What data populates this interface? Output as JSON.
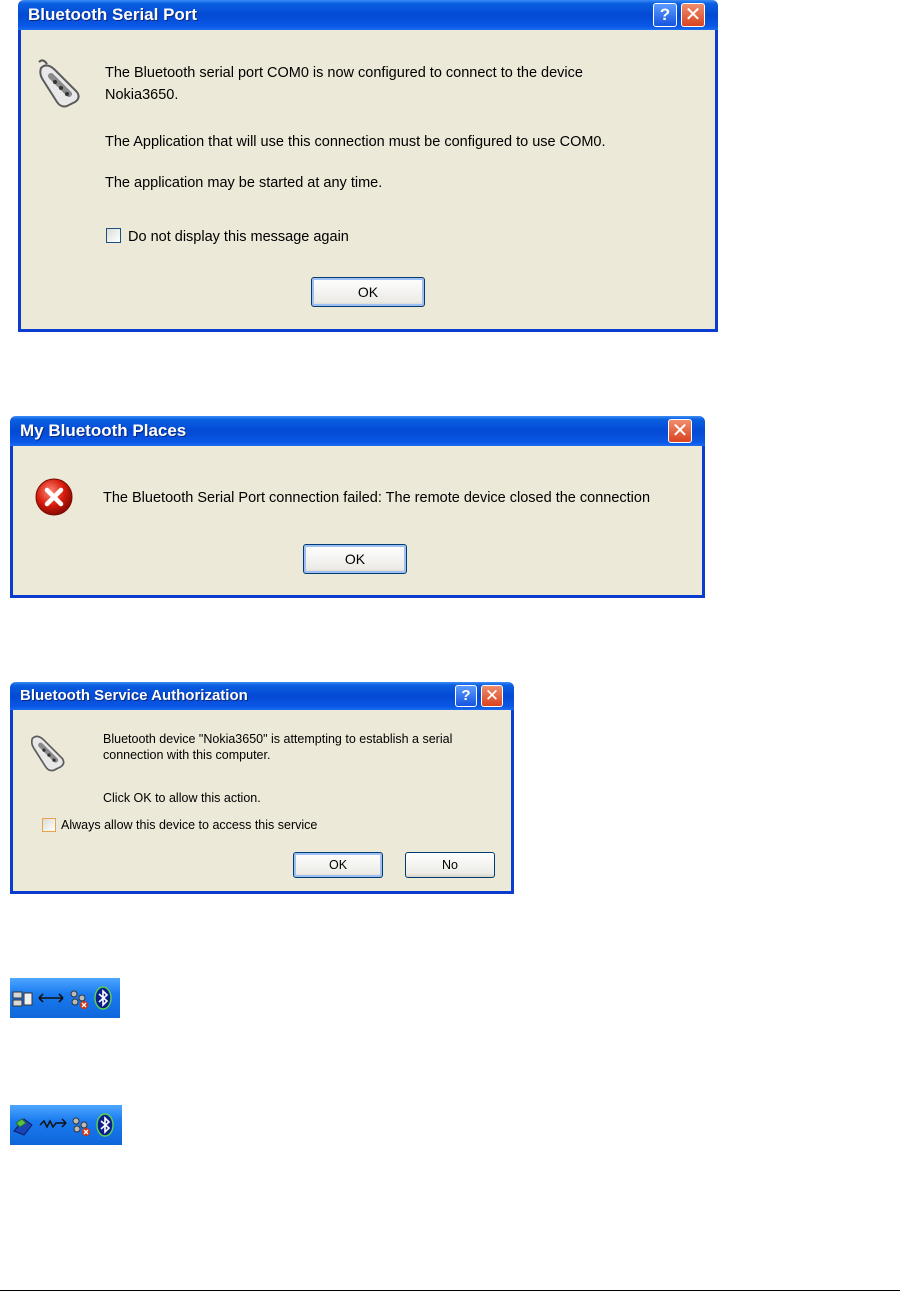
{
  "dialog1": {
    "title": "Bluetooth Serial Port",
    "line1": "The Bluetooth serial port COM0 is now configured to connect to the device",
    "line2": "Nokia3650.",
    "line3": "The Application that will use this connection must be configured to use COM0.",
    "line4": "The application may be started at any time.",
    "checkbox_label": "Do not display this message again",
    "ok_label": "OK",
    "help_label": "?",
    "close_label": "✕"
  },
  "dialog2": {
    "title": "My Bluetooth Places",
    "message": "The Bluetooth Serial Port connection failed:  The remote device closed the connection",
    "ok_label": "OK",
    "close_label": "✕"
  },
  "dialog3": {
    "title": "Bluetooth Service Authorization",
    "line1": "Bluetooth device \"Nokia3650\" is attempting to establish a serial",
    "line2": "connection with this computer.",
    "line3": "Click OK to allow this action.",
    "checkbox_label": "Always allow this device to access this service",
    "ok_label": "OK",
    "no_label": "No",
    "help_label": "?",
    "close_label": "✕"
  },
  "tray1": {
    "icons": [
      "network-connection-icon",
      "serial-arrow-icon",
      "security-warning-icon",
      "bluetooth-icon"
    ]
  },
  "tray2": {
    "icons": [
      "connected-device-icon",
      "active-connection-icon",
      "security-warning-icon",
      "bluetooth-icon"
    ]
  },
  "colors": {
    "titlebar": "#0349d4",
    "dialog_bg": "#ece9d8",
    "tray_bg": "#1a7bf0"
  }
}
